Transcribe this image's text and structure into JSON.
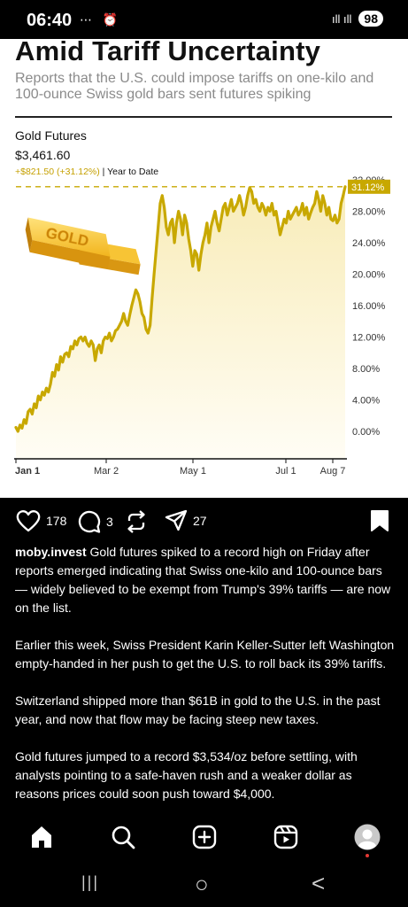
{
  "status_bar": {
    "time": "06:40",
    "left_icons": "⋯ ⏰",
    "signal": "ıll ıll",
    "battery": "98"
  },
  "post_image": {
    "headline": "Amid Tariff Uncertainty",
    "subhead": "Reports that the U.S. could impose tariffs on one-kilo and 100-ounce Swiss gold bars sent futures spiking",
    "instrument": "Gold Futures",
    "price": "$3,461.60",
    "change": "+$821.50 (+31.12%)",
    "period": "| Year to Date",
    "gold_bar_label": "GOLD"
  },
  "chart_data": {
    "type": "area",
    "title": "Gold Futures",
    "ylabel": "",
    "xlabel": "",
    "x_ticks": [
      "Jan 1",
      "Mar 2",
      "May 1",
      "Jul 1",
      "Aug 7"
    ],
    "y_ticks": [
      "0.00%",
      "4.00%",
      "8.00%",
      "12.00%",
      "16.00%",
      "20.00%",
      "24.00%",
      "28.00%",
      "32.00%"
    ],
    "ylim": [
      -2,
      32
    ],
    "current_label": "31.12%",
    "current_value": 31.12,
    "line_color": "#c8a800",
    "fill_color": "#fbf3cf",
    "series": [
      {
        "values": [
          0.5,
          0,
          0.8,
          0.4,
          1.5,
          1,
          2.5,
          2.8,
          2.2,
          3.5,
          3,
          4.5,
          4,
          5,
          4.6,
          5.5,
          5,
          6,
          7.5,
          7,
          8.5,
          7.8,
          9.5,
          8.8,
          9.8,
          10,
          9.5,
          10.8,
          10.5,
          11.5,
          11,
          11.8,
          12,
          11.5,
          12,
          11.2,
          10.8,
          11.5,
          11,
          9,
          10.5,
          11,
          10,
          11.5,
          12,
          11.8,
          12.5,
          11.5,
          12,
          12.8,
          13,
          13.5,
          14,
          15,
          14,
          13.5,
          14.8,
          16,
          17,
          18,
          17.5,
          16.5,
          15,
          14.5,
          13,
          12.5,
          13.5,
          17,
          20,
          23,
          26,
          29,
          30,
          28.5,
          26,
          25,
          26.5,
          27,
          24,
          26.5,
          28,
          27,
          25,
          27.5,
          26.5,
          24.5,
          23,
          21,
          23,
          22.5,
          20.5,
          22.5,
          24,
          25,
          26.5,
          24,
          26,
          27,
          28,
          26.5,
          25.5,
          27,
          28.5,
          29,
          27.5,
          28.5,
          29.5,
          28,
          28.5,
          29,
          30,
          29,
          27.5,
          28.5,
          30,
          31,
          30.5,
          29,
          29.5,
          28.5,
          28,
          29,
          28.5,
          27.5,
          28.5,
          28,
          29,
          27.5,
          28,
          26.5,
          25,
          26,
          27,
          26.5,
          28,
          27,
          27.5,
          28,
          28.5,
          27.5,
          28,
          29,
          27.5,
          28.5,
          27,
          27.8,
          28.5,
          29,
          30.5,
          29.5,
          28,
          30,
          29,
          27.5,
          28.5,
          27,
          26.8,
          27.5,
          26.5,
          27,
          29,
          30,
          31.12
        ]
      }
    ]
  },
  "actions": {
    "likes": "178",
    "comments": "3",
    "shares": "27"
  },
  "caption": {
    "username": "moby.invest",
    "p1": "Gold futures spiked to a record high on Friday after reports emerged indicating that Swiss one-kilo and 100-ounce bars — widely believed to be exempt from Trump's 39% tariffs — are now on the list.",
    "p2": "Earlier this week, Swiss President Karin Keller-Sutter left Washington empty-handed in her push to get the U.S. to roll back its 39% tariffs.",
    "p3": "Switzerland shipped more than $61B in gold to the U.S. in the past year, and now that flow may be facing steep new taxes.",
    "p4": "Gold futures jumped to a record $3,534/oz before settling, with analysts pointing to a safe-haven rush and a weaker dollar as reasons prices could soon push toward $4,000."
  },
  "bottom_nav": {
    "items": [
      "home-icon",
      "search-icon",
      "create-icon",
      "reels-icon",
      "profile-avatar"
    ]
  },
  "system_nav": {
    "recents": "|||",
    "home": "○",
    "back": "<"
  }
}
